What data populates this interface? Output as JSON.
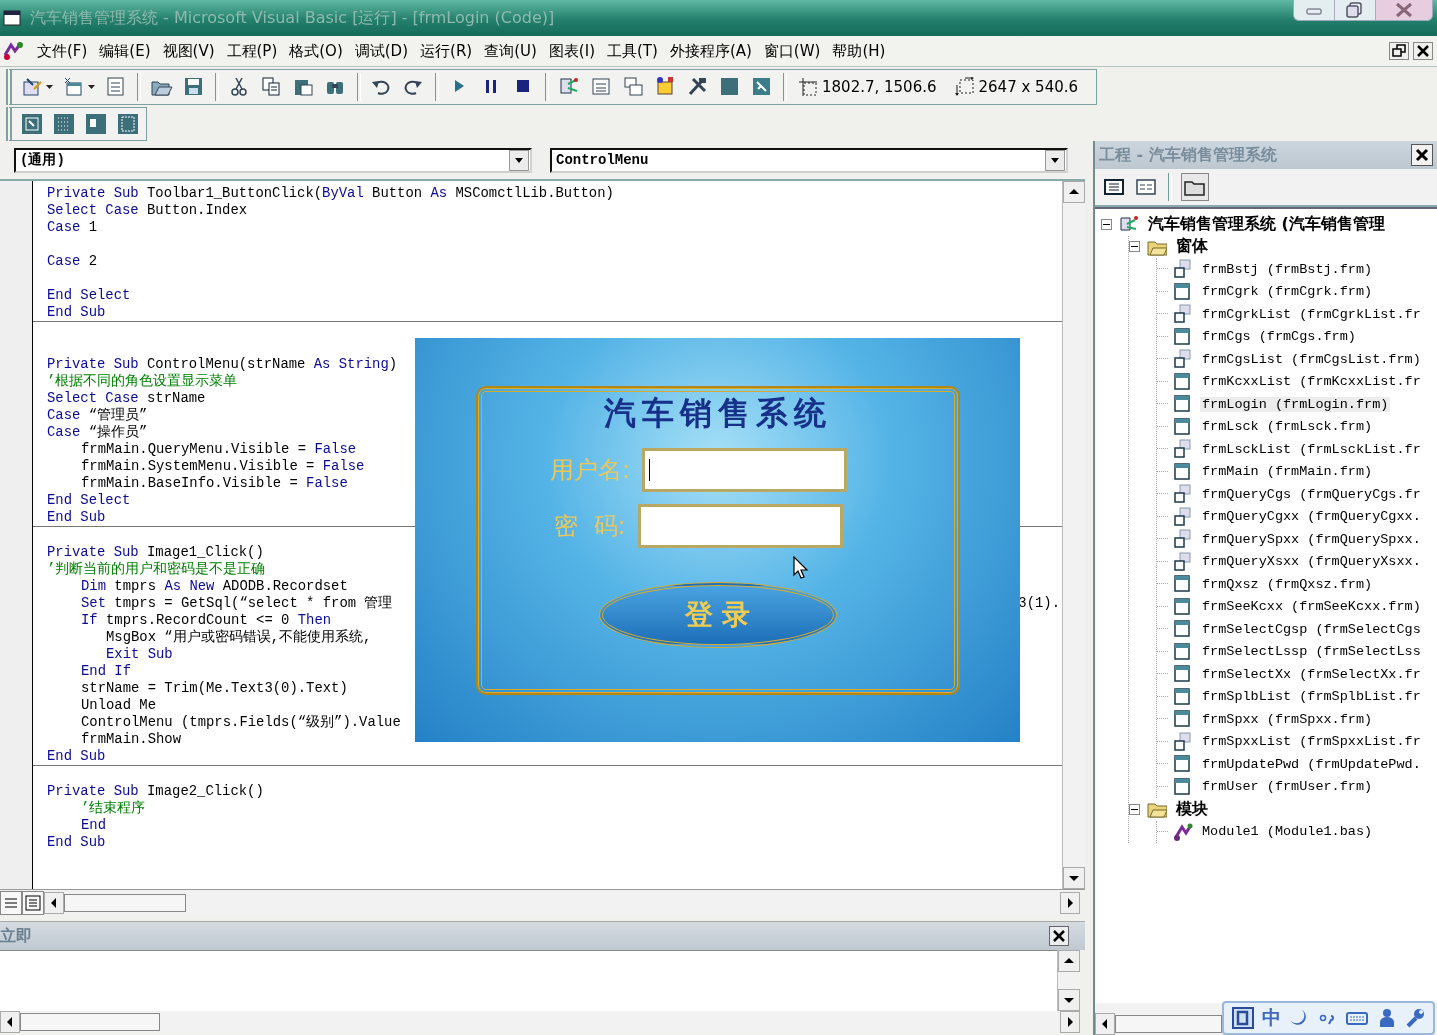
{
  "window": {
    "title": "汽车销售管理系统 - Microsoft Visual Basic [运行] - [frmLogin (Code)]"
  },
  "menu": [
    "文件(F)",
    "编辑(E)",
    "视图(V)",
    "工程(P)",
    "格式(O)",
    "调试(D)",
    "运行(R)",
    "查询(U)",
    "图表(I)",
    "工具(T)",
    "外接程序(A)",
    "窗口(W)",
    "帮助(H)"
  ],
  "toolbar": {
    "position": "1802.7, 1506.6",
    "size": "2647 x 540.6"
  },
  "code_window": {
    "object_combo": "(通用)",
    "procedure_combo": "ControlMenu",
    "procedures": [
      {
        "lines": [
          {
            "kind": "code",
            "parts": [
              {
                "kind": "keyword",
                "text": "Private Sub"
              },
              {
                "kind": "text",
                "text": " Toolbar1_ButtonClick("
              },
              {
                "kind": "keyword",
                "text": "ByVal"
              },
              {
                "kind": "text",
                "text": " Button "
              },
              {
                "kind": "keyword",
                "text": "As"
              },
              {
                "kind": "text",
                "text": " MSComctlLib.Button)"
              }
            ]
          },
          {
            "kind": "code",
            "parts": [
              {
                "kind": "keyword",
                "text": "Select Case"
              },
              {
                "kind": "text",
                "text": " Button.Index"
              }
            ]
          },
          {
            "kind": "code",
            "parts": [
              {
                "kind": "keyword",
                "text": "Case"
              },
              {
                "kind": "text",
                "text": " 1"
              }
            ]
          },
          {
            "kind": "blank"
          },
          {
            "kind": "code",
            "parts": [
              {
                "kind": "keyword",
                "text": "Case"
              },
              {
                "kind": "text",
                "text": " 2"
              }
            ]
          },
          {
            "kind": "blank"
          },
          {
            "kind": "code",
            "parts": [
              {
                "kind": "keyword",
                "text": "End Select"
              }
            ]
          },
          {
            "kind": "code",
            "parts": [
              {
                "kind": "keyword",
                "text": "End Sub"
              }
            ]
          }
        ]
      },
      {
        "lines": [
          {
            "kind": "blank"
          },
          {
            "kind": "code",
            "parts": [
              {
                "kind": "keyword",
                "text": "Private Sub"
              },
              {
                "kind": "text",
                "text": " ControlMenu(strName "
              },
              {
                "kind": "keyword",
                "text": "As String"
              },
              {
                "kind": "text",
                "text": ")"
              }
            ]
          },
          {
            "kind": "code",
            "parts": [
              {
                "kind": "comment",
                "text": "’根据不同的角色设置显示菜单"
              }
            ]
          },
          {
            "kind": "code",
            "parts": [
              {
                "kind": "keyword",
                "text": "Select Case"
              },
              {
                "kind": "text",
                "text": " strName"
              }
            ]
          },
          {
            "kind": "code",
            "parts": [
              {
                "kind": "keyword",
                "text": "Case"
              },
              {
                "kind": "text",
                "text": " “管理员”"
              }
            ]
          },
          {
            "kind": "code",
            "parts": [
              {
                "kind": "keyword",
                "text": "Case"
              },
              {
                "kind": "text",
                "text": " “操作员”"
              }
            ]
          },
          {
            "kind": "inner",
            "parts": [
              {
                "kind": "text",
                "text": "frmMain.QueryMenu.Visible = "
              },
              {
                "kind": "keyword",
                "text": "False"
              }
            ]
          },
          {
            "kind": "inner",
            "parts": [
              {
                "kind": "text",
                "text": "frmMain.SystemMenu.Visible = "
              },
              {
                "kind": "keyword",
                "text": "False"
              }
            ]
          },
          {
            "kind": "inner",
            "parts": [
              {
                "kind": "text",
                "text": "frmMain.BaseInfo.Visible = "
              },
              {
                "kind": "keyword",
                "text": "False"
              }
            ]
          },
          {
            "kind": "code",
            "parts": [
              {
                "kind": "keyword",
                "text": "End Select"
              }
            ]
          },
          {
            "kind": "code",
            "parts": [
              {
                "kind": "keyword",
                "text": "End Sub"
              }
            ]
          }
        ]
      },
      {
        "lines": [
          {
            "kind": "code",
            "parts": [
              {
                "kind": "keyword",
                "text": "Private Sub"
              },
              {
                "kind": "text",
                "text": " Image1_Click()"
              }
            ]
          },
          {
            "kind": "code",
            "parts": [
              {
                "kind": "comment",
                "text": "’判断当前的用户和密码是不是正确"
              }
            ]
          },
          {
            "kind": "inner",
            "parts": [
              {
                "kind": "keyword",
                "text": "Dim"
              },
              {
                "kind": "text",
                "text": " tmprs "
              },
              {
                "kind": "keyword",
                "text": "As New"
              },
              {
                "kind": "text",
                "text": " ADODB.Recordset"
              }
            ]
          },
          {
            "kind": "inner",
            "parts": [
              {
                "kind": "keyword",
                "text": "Set"
              },
              {
                "kind": "text",
                "text": " tmprs = GetSql(“select * from 管理"
              }
            ],
            "tail": "3(1)."
          },
          {
            "kind": "inner",
            "parts": [
              {
                "kind": "keyword",
                "text": "If"
              },
              {
                "kind": "text",
                "text": " tmprs.RecordCount <= 0 "
              },
              {
                "kind": "keyword",
                "text": "Then"
              }
            ]
          },
          {
            "kind": "deeper",
            "parts": [
              {
                "kind": "text",
                "text": "MsgBox “用户或密码错误,不能使用系统,"
              }
            ]
          },
          {
            "kind": "deeper",
            "parts": [
              {
                "kind": "keyword",
                "text": "Exit Sub"
              }
            ]
          },
          {
            "kind": "inner",
            "parts": [
              {
                "kind": "keyword",
                "text": "End If"
              }
            ]
          },
          {
            "kind": "inner",
            "parts": [
              {
                "kind": "text",
                "text": "strName = Trim(Me.Text3(0).Text)"
              }
            ]
          },
          {
            "kind": "inner",
            "parts": [
              {
                "kind": "text",
                "text": "Unload Me"
              }
            ]
          },
          {
            "kind": "inner",
            "parts": [
              {
                "kind": "text",
                "text": "ControlMenu (tmprs.Fields(“级别”).Value"
              }
            ]
          },
          {
            "kind": "inner",
            "parts": [
              {
                "kind": "text",
                "text": "frmMain.Show"
              }
            ]
          },
          {
            "kind": "code",
            "parts": [
              {
                "kind": "keyword",
                "text": "End Sub"
              }
            ]
          }
        ]
      },
      {
        "lines": [
          {
            "kind": "code",
            "parts": [
              {
                "kind": "keyword",
                "text": "Private Sub"
              },
              {
                "kind": "text",
                "text": " Image2_Click()"
              }
            ]
          },
          {
            "kind": "inner",
            "parts": [
              {
                "kind": "comment",
                "text": "’结束程序"
              }
            ]
          },
          {
            "kind": "inner",
            "parts": [
              {
                "kind": "keyword",
                "text": "End"
              }
            ]
          },
          {
            "kind": "code",
            "parts": [
              {
                "kind": "keyword",
                "text": "End Sub"
              }
            ]
          }
        ]
      }
    ]
  },
  "login_form": {
    "title": "汽车销售系统",
    "username_label": "用户名:",
    "password_label": "密  码:",
    "login_button": "登 录"
  },
  "immediate_window": {
    "title": "立即"
  },
  "project_panel": {
    "title": "工程 - 汽车销售管理系统",
    "tree": [
      {
        "label": "汽车销售管理系统 (汽车销售管理",
        "kind": "project",
        "expanded": true,
        "selected": false,
        "children": [
          {
            "label": "窗体",
            "kind": "folder",
            "expanded": true,
            "selected": false,
            "children": [
              {
                "label": "frmBstj (frmBstj.frm)",
                "kind": "badged",
                "selected": false
              },
              {
                "label": "frmCgrk (frmCgrk.frm)",
                "kind": "form",
                "selected": false
              },
              {
                "label": "frmCgrkList (frmCgrkList.fr",
                "kind": "badged",
                "selected": false
              },
              {
                "label": "frmCgs (frmCgs.frm)",
                "kind": "form",
                "selected": false
              },
              {
                "label": "frmCgsList (frmCgsList.frm)",
                "kind": "badged",
                "selected": false
              },
              {
                "label": "frmKcxxList (frmKcxxList.fr",
                "kind": "form",
                "selected": false
              },
              {
                "label": "frmLogin (frmLogin.frm)",
                "kind": "form",
                "selected": true
              },
              {
                "label": "frmLsck (frmLsck.frm)",
                "kind": "form",
                "selected": false
              },
              {
                "label": "frmLsckList (frmLsckList.fr",
                "kind": "badged",
                "selected": false
              },
              {
                "label": "frmMain (frmMain.frm)",
                "kind": "form",
                "selected": false
              },
              {
                "label": "frmQueryCgs (frmQueryCgs.fr",
                "kind": "badged",
                "selected": false
              },
              {
                "label": "frmQueryCgxx (frmQueryCgxx.",
                "kind": "badged",
                "selected": false
              },
              {
                "label": "frmQuerySpxx (frmQuerySpxx.",
                "kind": "badged",
                "selected": false
              },
              {
                "label": "frmQueryXsxx (frmQueryXsxx.",
                "kind": "badged",
                "selected": false
              },
              {
                "label": "frmQxsz (frmQxsz.frm)",
                "kind": "form",
                "selected": false
              },
              {
                "label": "frmSeeKcxx (frmSeeKcxx.frm)",
                "kind": "form",
                "selected": false
              },
              {
                "label": "frmSelectCgsp (frmSelectCgs",
                "kind": "form",
                "selected": false
              },
              {
                "label": "frmSelectLssp (frmSelectLss",
                "kind": "form",
                "selected": false
              },
              {
                "label": "frmSelectXx (frmSelectXx.fr",
                "kind": "form",
                "selected": false
              },
              {
                "label": "frmSplbList (frmSplbList.fr",
                "kind": "form",
                "selected": false
              },
              {
                "label": "frmSpxx (frmSpxx.frm)",
                "kind": "form",
                "selected": false
              },
              {
                "label": "frmSpxxList (frmSpxxList.fr",
                "kind": "badged",
                "selected": false
              },
              {
                "label": "frmUpdatePwd (frmUpdatePwd.",
                "kind": "form",
                "selected": false
              },
              {
                "label": "frmUser (frmUser.frm)",
                "kind": "form",
                "selected": false
              }
            ]
          },
          {
            "label": "模块",
            "kind": "folder",
            "expanded": true,
            "selected": false,
            "children": [
              {
                "label": "Module1 (Module1.bas)",
                "kind": "module",
                "selected": false
              }
            ]
          }
        ]
      }
    ]
  },
  "ime_bar": {
    "mode": "中"
  }
}
